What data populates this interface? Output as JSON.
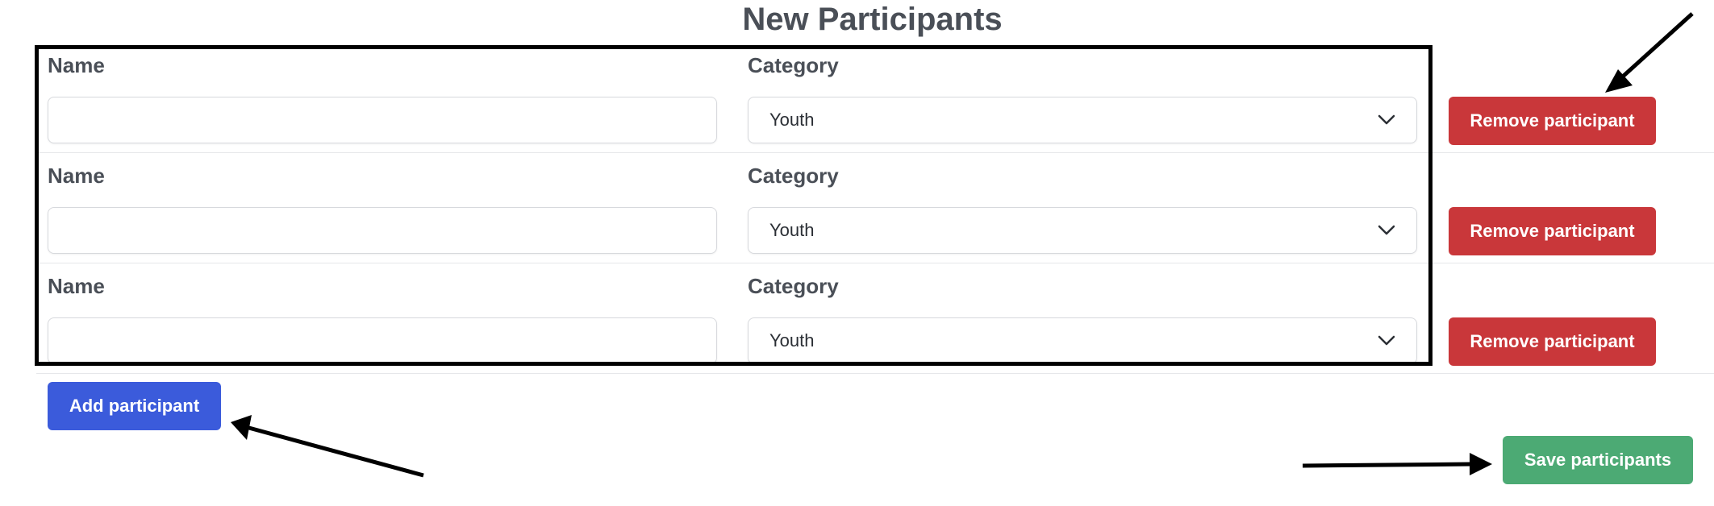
{
  "page": {
    "title": "New Participants"
  },
  "participants": [
    {
      "name_label": "Name",
      "name_value": "",
      "category_label": "Category",
      "category_value": "Youth",
      "remove_label": "Remove participant"
    },
    {
      "name_label": "Name",
      "name_value": "",
      "category_label": "Category",
      "category_value": "Youth",
      "remove_label": "Remove participant"
    },
    {
      "name_label": "Name",
      "name_value": "",
      "category_label": "Category",
      "category_value": "Youth",
      "remove_label": "Remove participant"
    }
  ],
  "actions": {
    "add_label": "Add participant",
    "save_label": "Save participants"
  },
  "colors": {
    "remove": "#c9373a",
    "add": "#3b5bdb",
    "save": "#4caa74",
    "text": "#4a4f57"
  },
  "icons": {
    "select_indicator": "chevron-down-icon",
    "annotation": "arrow-icon"
  }
}
